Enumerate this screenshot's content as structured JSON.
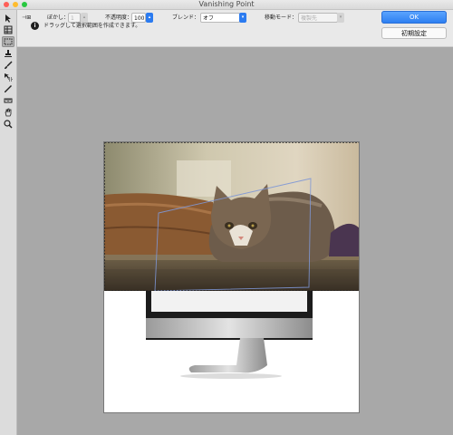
{
  "window": {
    "title": "Vanishing Point"
  },
  "options": {
    "blur_label": "ぼかし：",
    "blur_value": "1",
    "opacity_label": "不透明度：",
    "opacity_value": "100",
    "blend_label": "ブレンド：",
    "blend_value": "オフ",
    "move_mode_label": "移動モード：",
    "move_mode_value": "複製先"
  },
  "hint_text": "ドラッグして選択範囲を作成できます。",
  "buttons": {
    "ok": "OK",
    "reset": "初期設定"
  },
  "tools": [
    {
      "name": "edit-plane-tool-icon",
      "active": false
    },
    {
      "name": "create-plane-tool-icon",
      "active": false
    },
    {
      "name": "marquee-tool-icon",
      "active": true
    },
    {
      "name": "stamp-tool-icon",
      "active": false
    },
    {
      "name": "brush-tool-icon",
      "active": false
    },
    {
      "name": "transform-tool-icon",
      "active": false
    },
    {
      "name": "eyedropper-tool-icon",
      "active": false
    },
    {
      "name": "measure-tool-icon",
      "active": false
    },
    {
      "name": "hand-tool-icon",
      "active": false
    },
    {
      "name": "zoom-tool-icon",
      "active": false
    }
  ],
  "colors": {
    "accent": "#2a7cf0",
    "canvas_bg": "#a8a8a8",
    "selection_plane": "#7e97d6"
  }
}
